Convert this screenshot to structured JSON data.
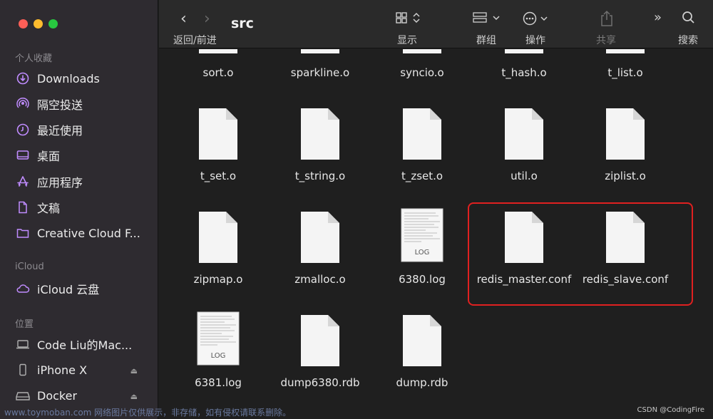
{
  "colors": {
    "close": "#fe5f57",
    "minimize": "#febc2e",
    "zoom": "#28c840",
    "accent": "#c08cff",
    "highlight": "#e02020"
  },
  "sidebar": {
    "favorites_header": "个人收藏",
    "favorites": [
      {
        "label": "Downloads",
        "icon": "download-icon"
      },
      {
        "label": "隔空投送",
        "icon": "airdrop-icon"
      },
      {
        "label": "最近使用",
        "icon": "clock-icon"
      },
      {
        "label": "桌面",
        "icon": "desktop-icon"
      },
      {
        "label": "应用程序",
        "icon": "apps-icon"
      },
      {
        "label": "文稿",
        "icon": "document-icon"
      },
      {
        "label": "Creative Cloud F...",
        "icon": "folder-icon"
      }
    ],
    "icloud_header": "iCloud",
    "icloud": [
      {
        "label": "iCloud 云盘",
        "icon": "cloud-icon"
      }
    ],
    "locations_header": "位置",
    "locations": [
      {
        "label": "Code Liu的Mac...",
        "icon": "laptop-icon"
      },
      {
        "label": "iPhone X",
        "icon": "phone-icon"
      },
      {
        "label": "Docker",
        "icon": "drive-icon"
      }
    ]
  },
  "toolbar": {
    "title": "src",
    "back_forward": "返回/前进",
    "view": "显示",
    "group": "群组",
    "action": "操作",
    "share": "共享",
    "search": "搜索"
  },
  "files": [
    {
      "name": "sort.o",
      "type": "blank"
    },
    {
      "name": "sparkline.o",
      "type": "blank"
    },
    {
      "name": "syncio.o",
      "type": "blank"
    },
    {
      "name": "t_hash.o",
      "type": "blank"
    },
    {
      "name": "t_list.o",
      "type": "blank"
    },
    {
      "name": "t_set.o",
      "type": "blank"
    },
    {
      "name": "t_string.o",
      "type": "blank"
    },
    {
      "name": "t_zset.o",
      "type": "blank"
    },
    {
      "name": "util.o",
      "type": "blank"
    },
    {
      "name": "ziplist.o",
      "type": "blank"
    },
    {
      "name": "zipmap.o",
      "type": "blank"
    },
    {
      "name": "zmalloc.o",
      "type": "blank"
    },
    {
      "name": "6380.log",
      "type": "log",
      "badge": "LOG"
    },
    {
      "name": "redis_master.conf",
      "type": "blank"
    },
    {
      "name": "redis_slave.conf",
      "type": "blank"
    },
    {
      "name": "6381.log",
      "type": "log",
      "badge": "LOG"
    },
    {
      "name": "dump6380.rdb",
      "type": "blank"
    },
    {
      "name": "dump.rdb",
      "type": "blank"
    }
  ],
  "watermark": {
    "left": "www.toymoban.com 网络图片仅供展示，非存储，如有侵权请联系删除。",
    "right": "CSDN @CodingFire"
  }
}
